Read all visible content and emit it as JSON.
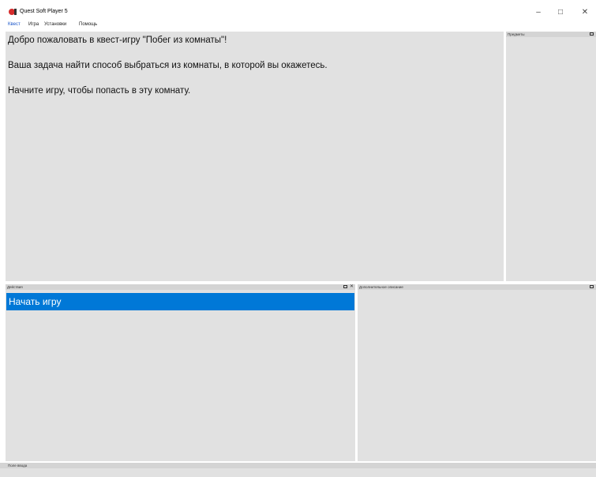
{
  "window": {
    "title": "Quest Soft Player 5",
    "minimize_glyph": "–",
    "maximize_glyph": "□",
    "close_glyph": "✕"
  },
  "menu": {
    "items": [
      "Квест",
      "Игра",
      "Установки",
      "Помощь"
    ]
  },
  "quest_pane": {
    "lines": [
      "Добро пожаловать в квест-игру \"Побег из комнаты\"!",
      "Ваша задача найти способ выбраться из комнаты, в которой вы окажетесь.",
      "Начните игру, чтобы попасть в эту комнату."
    ]
  },
  "items_pane": {
    "title": "Предметы"
  },
  "actions_pane": {
    "title": "Действия",
    "items": [
      "Начать игру"
    ],
    "close_glyph": "✕"
  },
  "description_pane": {
    "title": "Дополнительное описание"
  },
  "input_pane": {
    "title": "Поле ввода"
  },
  "colors": {
    "selection": "#0078d7",
    "panel_bg": "#e1e1e1",
    "header_bg": "#d4d4d4",
    "app_icon": "#d62c2c"
  }
}
